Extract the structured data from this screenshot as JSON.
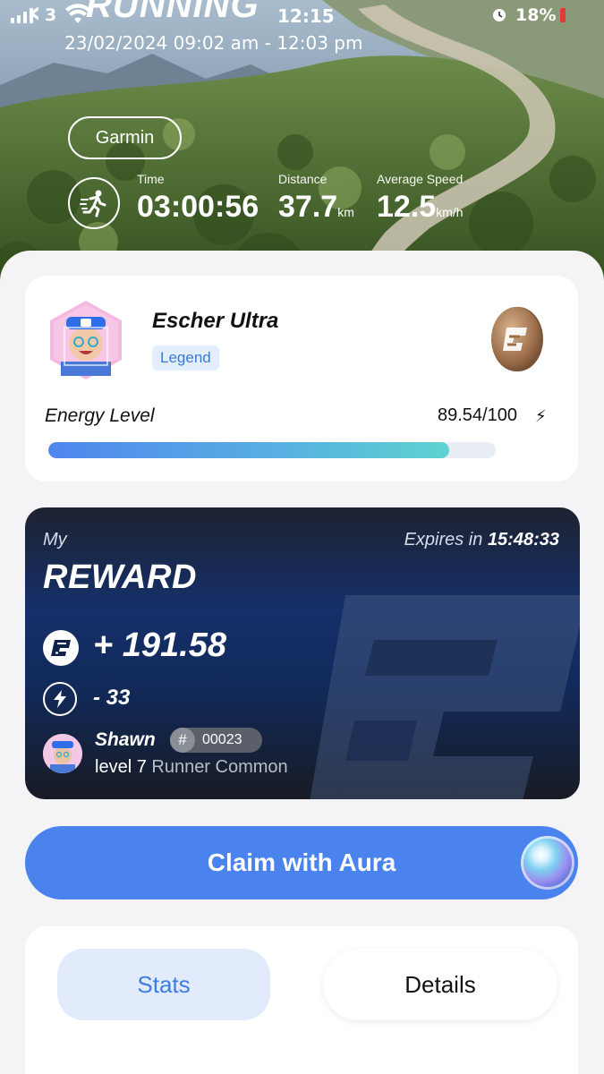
{
  "status_bar": {
    "carrier": "3",
    "time": "12:15",
    "battery": "18%"
  },
  "header": {
    "title": "RUNNING",
    "date_range": "23/02/2024 09:02 am - 12:03 pm",
    "source": "Garmin"
  },
  "metrics": [
    {
      "label": "Time",
      "value": "03:00:56",
      "unit": ""
    },
    {
      "label": "Distance",
      "value": "37.7",
      "unit": "km"
    },
    {
      "label": "Average Speed",
      "value": "12.5",
      "unit": "km/h"
    }
  ],
  "profile": {
    "name": "Escher Ultra",
    "rank": "Legend",
    "energy_label": "Energy Level",
    "energy_value": "89.54/100",
    "energy_fraction": 0.8954
  },
  "reward": {
    "my_label": "My",
    "expires_label": "Expires in",
    "expires_time": "15:48:33",
    "title": "REWARD",
    "amount": "+ 191.58",
    "energy_cost": "- 33",
    "user_name": "Shawn",
    "hash_symbol": "#",
    "user_id": "00023",
    "level": "level 7",
    "tier": "Runner Common"
  },
  "claim": {
    "label": "Claim with Aura"
  },
  "tabs": [
    {
      "label": "Stats",
      "active": true
    },
    {
      "label": "Details",
      "active": false
    }
  ],
  "colors": {
    "accent": "#4a82ee",
    "badge_bg": "#e2eefb",
    "badge_text": "#3a7bd5",
    "reward_bg": "#15306a"
  },
  "icons": {
    "back": "chevron-left-icon",
    "run": "runner-icon",
    "coin": "dash-coin-icon",
    "bolt": "lightning-icon",
    "aura": "aura-orb-icon"
  }
}
